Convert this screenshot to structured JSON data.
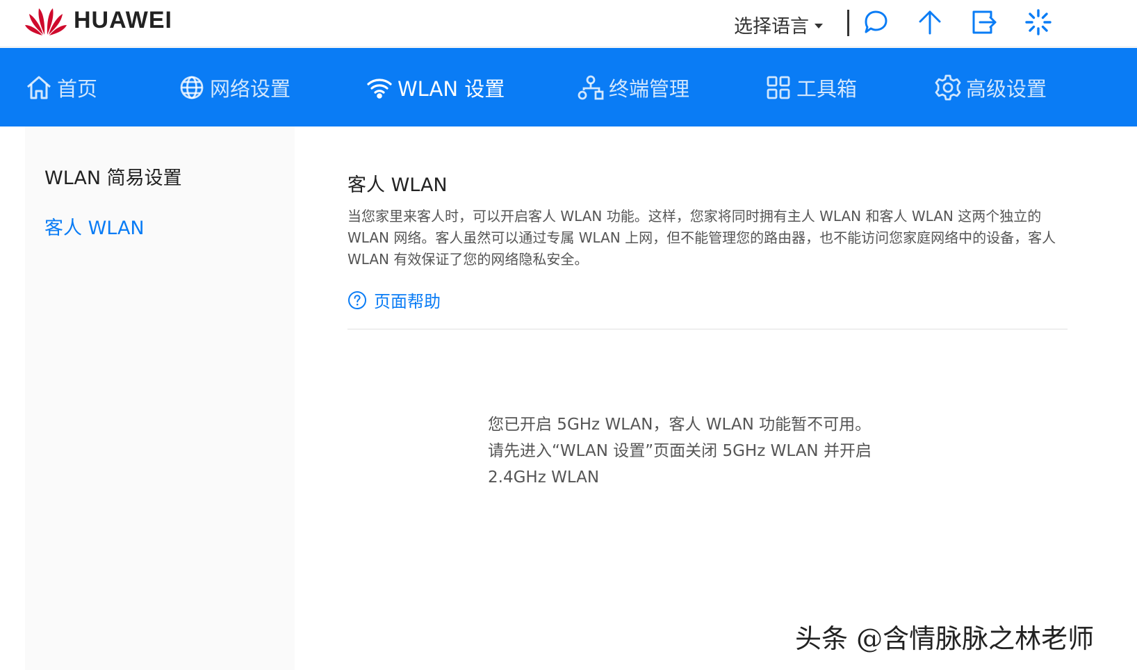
{
  "header": {
    "brand": "HUAWEI",
    "language_label": "选择语言",
    "colors": {
      "brand_red": "#cf0a2c",
      "accent_blue": "#0a7cf5"
    },
    "icons": [
      "chat-bubble-icon",
      "upload-arrow-icon",
      "logout-icon",
      "loading-spinner-icon"
    ]
  },
  "nav": {
    "items": [
      {
        "label": "首页",
        "icon": "home-icon"
      },
      {
        "label": "网络设置",
        "icon": "globe-icon"
      },
      {
        "label": "WLAN 设置",
        "icon": "wifi-icon",
        "active": true
      },
      {
        "label": "终端管理",
        "icon": "network-topology-icon"
      },
      {
        "label": "工具箱",
        "icon": "grid-tools-icon"
      },
      {
        "label": "高级设置",
        "icon": "gear-icon"
      }
    ]
  },
  "sidebar": {
    "items": [
      {
        "label": "WLAN 简易设置"
      },
      {
        "label": "客人 WLAN",
        "active": true
      }
    ]
  },
  "main": {
    "title": "客人 WLAN",
    "description": "当您家里来客人时，可以开启客人 WLAN 功能。这样，您家将同时拥有主人 WLAN 和客人 WLAN 这两个独立的 WLAN 网络。客人虽然可以通过专属 WLAN 上网，但不能管理您的路由器，也不能访问您家庭网络中的设备，客人 WLAN 有效保证了您的网络隐私安全。",
    "help_label": "页面帮助",
    "notice_lines": [
      "您已开启 5GHz WLAN，客人 WLAN 功能暂不可用。",
      "请先进入“WLAN 设置”页面关闭 5GHz WLAN 并开启",
      "2.4GHz WLAN"
    ]
  },
  "watermark": "头条 @含情脉脉之林老师"
}
